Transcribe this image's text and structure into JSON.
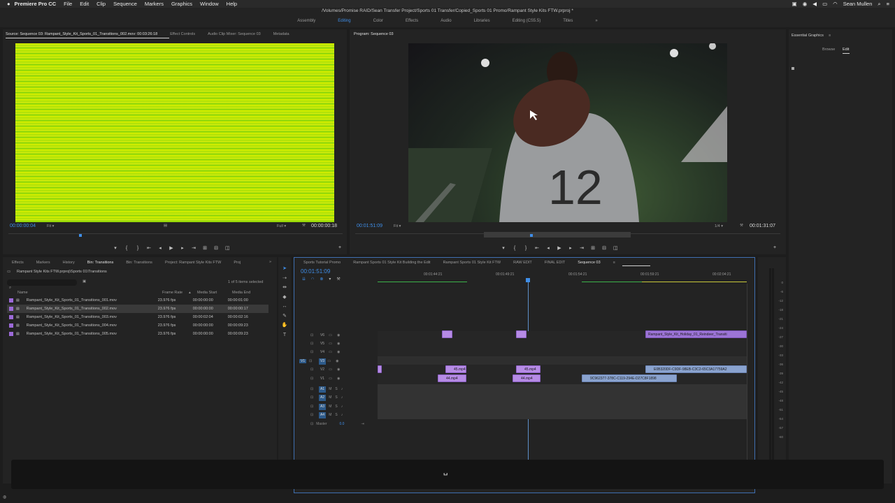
{
  "menubar": {
    "app": "Premiere Pro CC",
    "items": [
      "File",
      "Edit",
      "Clip",
      "Sequence",
      "Markers",
      "Graphics",
      "Window",
      "Help"
    ],
    "user": "Sean Mullen"
  },
  "titlebar": {
    "path": "/Volumes/Promise RAID/Sean Transfer Project/Sports 01 Transfer/Copied_Sports 01 Promo/Rampant Style Kits FTW.prproj *"
  },
  "workspaces": [
    {
      "label": "Assembly",
      "active": false
    },
    {
      "label": "Editing",
      "active": true
    },
    {
      "label": "Color",
      "active": false
    },
    {
      "label": "Effects",
      "active": false
    },
    {
      "label": "Audio",
      "active": false
    },
    {
      "label": "Libraries",
      "active": false
    },
    {
      "label": "Editing (CS5.5)",
      "active": false
    },
    {
      "label": "Titles",
      "active": false
    }
  ],
  "workspaces_more": "»",
  "source": {
    "tabs": [
      "Source: Sequence 03: Rampant_Style_Kit_Sports_01_Transitions_002.mov: 00:03:26:18",
      "Effect Controls",
      "Audio Clip Mixer: Sequence 03",
      "Metadata"
    ],
    "timecode": "00:00:00:04",
    "fit": "Fit",
    "quality": "Full",
    "duration": "00:00:00:18"
  },
  "program": {
    "tab": "Program: Sequence 03",
    "timecode": "00:01:51:09",
    "fit": "Fit",
    "resolution": "1/4",
    "duration": "00:01:31:07"
  },
  "essential_graphics": {
    "title": "Essential Graphics",
    "tabs": [
      "Browse",
      "Edit"
    ]
  },
  "project": {
    "tabs": [
      "Effects",
      "Markers",
      "History",
      "Bin: Transitions",
      "Bin: Transitions",
      "Project: Rampant Style Kits FTW",
      "Proj"
    ],
    "path": "Rampant Style Kits FTW.prproj\\Sports 01\\Transitions",
    "selected": "1 of 5 items selected",
    "columns": [
      "Name",
      "Frame Rate",
      "Media Start",
      "Media End"
    ],
    "items": [
      {
        "name": "Rampant_Style_Kit_Sports_01_Transitions_001.mov",
        "fps": "23.976 fps",
        "start": "00:00:00:00",
        "end": "00:00:01:00",
        "selected": false
      },
      {
        "name": "Rampant_Style_Kit_Sports_01_Transitions_002.mov",
        "fps": "23.976 fps",
        "start": "00:00:00:00",
        "end": "00:00:00:17",
        "selected": true
      },
      {
        "name": "Rampant_Style_Kit_Sports_01_Transitions_003.mov",
        "fps": "23.976 fps",
        "start": "00:00:02:04",
        "end": "00:00:02:16",
        "selected": false
      },
      {
        "name": "Rampant_Style_Kit_Sports_01_Transitions_004.mov",
        "fps": "23.976 fps",
        "start": "00:00:00:00",
        "end": "00:00:09:23",
        "selected": false
      },
      {
        "name": "Rampant_Style_Kit_Sports_01_Transitions_005.mov",
        "fps": "23.976 fps",
        "start": "00:00:00:00",
        "end": "00:00:09:23",
        "selected": false
      }
    ]
  },
  "timeline": {
    "tabs": [
      "Sports Tutorial Promo",
      "Rampant Sports 01 Style Kit Building the Edit",
      "Rampant Sports 01 Style Kit FTW",
      "RAW EDIT",
      "FINAL EDIT",
      "Sequence 03"
    ],
    "timecode": "00:01:51:09",
    "ruler": [
      "00:01:44:21",
      "00:01:49:21",
      "00:01:54:21",
      "00:01:59:21",
      "00:02:04:21"
    ],
    "video_tracks": [
      "V6",
      "V5",
      "V4",
      "V3",
      "V2",
      "V1"
    ],
    "audio_tracks": [
      "A1",
      "A2",
      "A3",
      "A4"
    ],
    "master": "Master",
    "master_value": "0.0",
    "clips": {
      "v6_c": "Rampant_Style_Kit_Holiday_01_Reindeer_Transiti",
      "v2_a": "45.mp4",
      "v2_b": "45.mp4",
      "v2_c": "E0B320DF-C9DF-98EB-C3C2-65C3A17759A2",
      "v1_a": "44.mp4",
      "v1_b": "44.mp4",
      "v1_c": "9C962377-378C-C119-294E-D27C8F1898"
    }
  },
  "meters": [
    "0",
    "-6",
    "-12",
    "-18",
    "-21",
    "-24",
    "-27",
    "-30",
    "-33",
    "-36",
    "-39",
    "-42",
    "-45",
    "-48",
    "-51",
    "-54",
    "-57",
    "-60"
  ],
  "meter_bottom": "S S",
  "caption_glyph": "␣"
}
